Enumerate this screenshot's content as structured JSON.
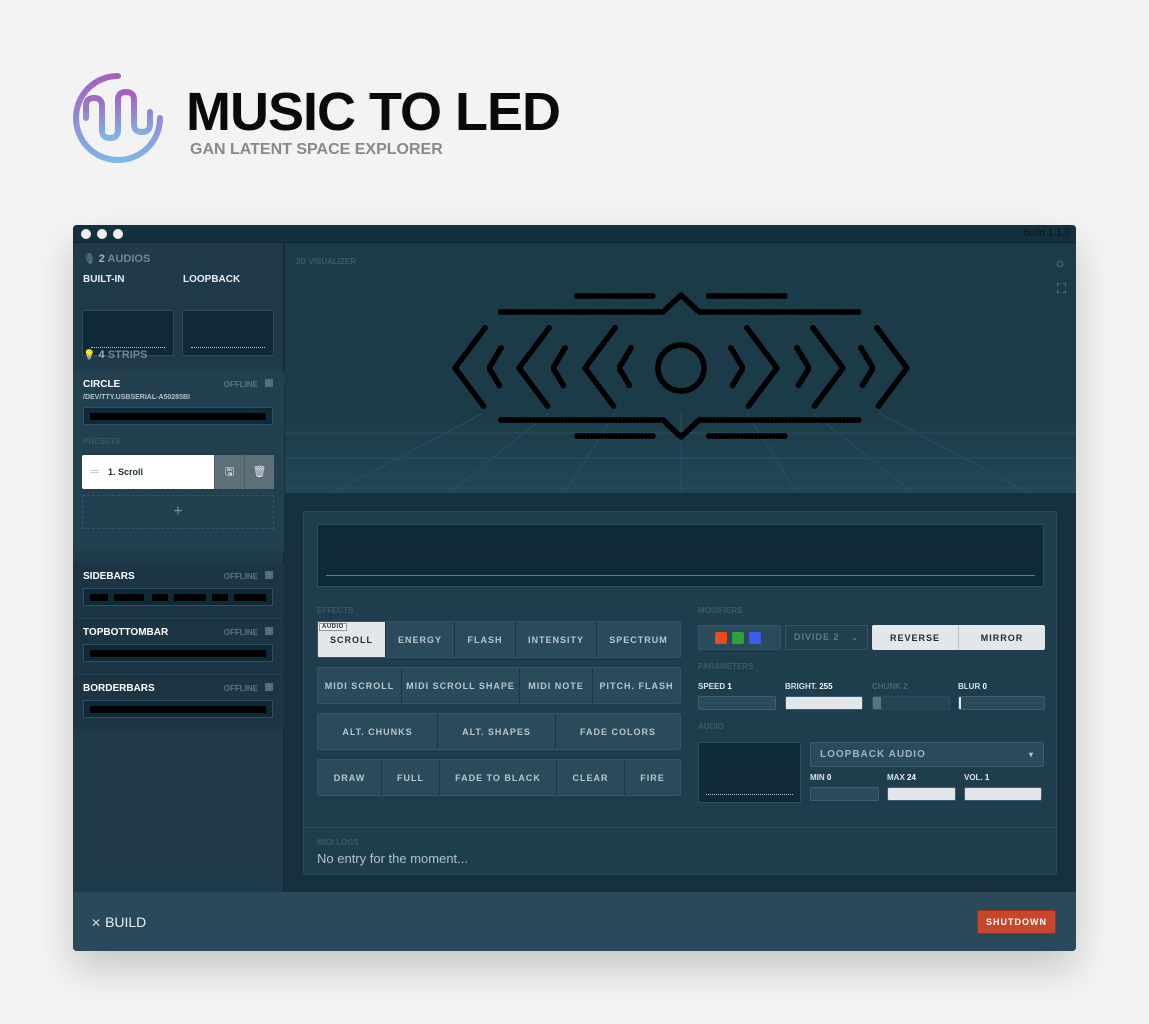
{
  "brand": {
    "title": "MUSIC TO LED",
    "subtitle": "GAN LATENT SPACE EXPLORER",
    "logo_icon": "wave-logo-icon",
    "gradient": [
      "#a45fbf",
      "#7fb6e6"
    ]
  },
  "window": {
    "build_version": "build 1.1.0"
  },
  "sidebar": {
    "audios_count": "2",
    "audios_label": "AUDIOS",
    "audio_inputs": [
      {
        "label": "BUILT-IN"
      },
      {
        "label": "LOOPBACK"
      }
    ],
    "strips_count": "4",
    "strips_label": "STRIPS",
    "strips": [
      {
        "name": "CIRCLE",
        "status": "OFFLINE",
        "path": "/DEV/TTY.USBSERIAL-A50285BI"
      },
      {
        "name": "SIDEBARS",
        "status": "OFFLINE"
      },
      {
        "name": "TOPBOTTOMBAR",
        "status": "OFFLINE"
      },
      {
        "name": "BORDERBARS",
        "status": "OFFLINE"
      }
    ],
    "presets_label": "PRESETS",
    "presets": [
      {
        "name": "1. Scroll"
      }
    ],
    "add_preset": "+"
  },
  "visualizer": {
    "label": "3D VISUALIZER",
    "settings_icon": "sun-icon",
    "fullscreen_icon": "fullscreen-icon"
  },
  "effects": {
    "label": "EFFECTS",
    "audio_tag": "AUDIO",
    "rows": [
      [
        "SCROLL",
        "ENERGY",
        "FLASH",
        "INTENSITY",
        "SPECTRUM"
      ],
      [
        "MIDI SCROLL",
        "MIDI SCROLL SHAPE",
        "MIDI NOTE",
        "PITCH. FLASH"
      ],
      [
        "ALT. CHUNKS",
        "ALT. SHAPES",
        "FADE COLORS"
      ],
      [
        "DRAW",
        "FULL",
        "FADE TO BLACK",
        "CLEAR",
        "FIRE"
      ]
    ],
    "active": "SCROLL"
  },
  "modifiers": {
    "label": "MODIFIERS",
    "colors": [
      "#e84d1c",
      "#2fa23a",
      "#3c5cf0"
    ],
    "divide": "DIVIDE 2",
    "reverse": "REVERSE",
    "mirror": "MIRROR"
  },
  "parameters": {
    "label": "PARAMETERS",
    "items": [
      {
        "name": "SPEED",
        "value": "1",
        "fill": 0.0
      },
      {
        "name": "BRIGHT.",
        "value": "255",
        "fill": 1.0
      },
      {
        "name": "CHUNK",
        "value": "2",
        "fill": 0.1
      },
      {
        "name": "BLUR",
        "value": "0",
        "fill": 0.02
      }
    ]
  },
  "audio": {
    "label": "AUDIO",
    "source": "LOOPBACK AUDIO",
    "min_label": "MIN",
    "min_value": "0",
    "max_label": "MAX",
    "max_value": "24",
    "vol_label": "VOL.",
    "vol_value": "1"
  },
  "midi_logs": {
    "label": "MIDI LOGS",
    "text": "No entry for the moment..."
  },
  "footer": {
    "build_label": "BUILD",
    "shutdown": "SHUTDOWN",
    "shutdown_color": "#c8462a"
  }
}
